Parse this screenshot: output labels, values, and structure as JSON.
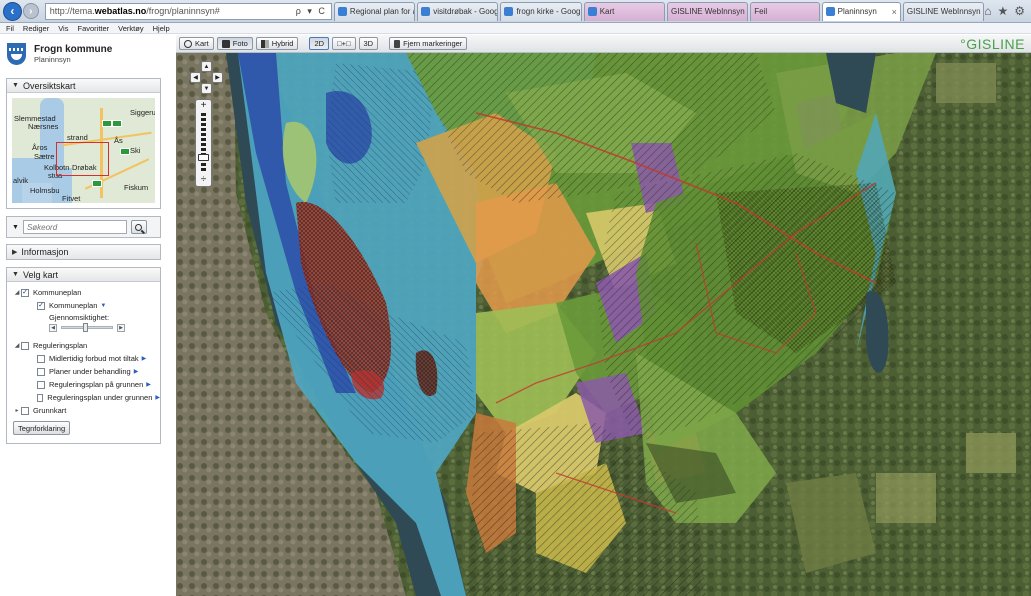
{
  "browser": {
    "url_prefix": "http://tema.",
    "url_host": "webatlas.no",
    "url_path": "/frogn/planinnsyn#",
    "addr_tools": "ρ ▾ C",
    "tabs": [
      {
        "label": "Regional plan for are...",
        "style": "normal"
      },
      {
        "label": "visitdrøbak - Google-...",
        "style": "normal"
      },
      {
        "label": "frogn kirke - Google-...",
        "style": "normal"
      },
      {
        "label": "Kart",
        "style": "purple"
      },
      {
        "label": "GISLINE WebInnsyn",
        "style": "purple"
      },
      {
        "label": "Feil",
        "style": "purple"
      },
      {
        "label": "Planinnsyn",
        "style": "active"
      },
      {
        "label": "GISLINE WebInnsyn",
        "style": "normal"
      }
    ],
    "tab_close": "×",
    "window_icons": [
      "⌂",
      "★",
      "⚙"
    ]
  },
  "menu": [
    "Fil",
    "Rediger",
    "Vis",
    "Favoritter",
    "Verktøy",
    "Hjelp"
  ],
  "app": {
    "name": "Frogn kommune",
    "subtitle": "Planinnsyn"
  },
  "toolbar": {
    "kart": "Kart",
    "foto": "Foto",
    "hybrid": "Hybrid",
    "view_2d": "2D",
    "view_mid": "□+□",
    "view_3d": "3D",
    "clear": "Fjern markeringer",
    "brand": "°GISLINE"
  },
  "sidebar": {
    "overview": {
      "title": "Oversiktskart",
      "labels": [
        "Siggerud",
        "Slemmestad",
        "Nærsnes",
        "strand",
        "Ås",
        "Ski",
        "Åros",
        "Sætre",
        "Kolbotn",
        "Drøbak",
        "alvik",
        "stua",
        "Holmsbu",
        "Fiskum",
        "Fitvet"
      ]
    },
    "search": {
      "placeholder": "Søkeord"
    },
    "info": {
      "title": "Informasjon"
    },
    "layers": {
      "title": "Velg kart",
      "kommuneplan_group": "Kommuneplan",
      "kommuneplan": "Kommuneplan",
      "opacity_label": "Gjennomsiktighet:",
      "opacity_value": 0.45,
      "regulering_group": "Reguleringsplan",
      "regulering_items": [
        "Midlertidig forbud mot tiltak",
        "Planer under behandling",
        "Reguleringsplan på grunnen",
        "Reguleringsplan under grunnen"
      ],
      "grunnkart": "Grunnkart",
      "legend_button": "Tegnforklaring"
    }
  },
  "colors": {
    "water": "#4fa8c4",
    "green_zone": "#6a9a3a",
    "yellow_zone": "#d7c86a",
    "purple_zone": "#8b5aa8",
    "red_zone": "#b8322e",
    "gisline": "#4aa04a"
  }
}
